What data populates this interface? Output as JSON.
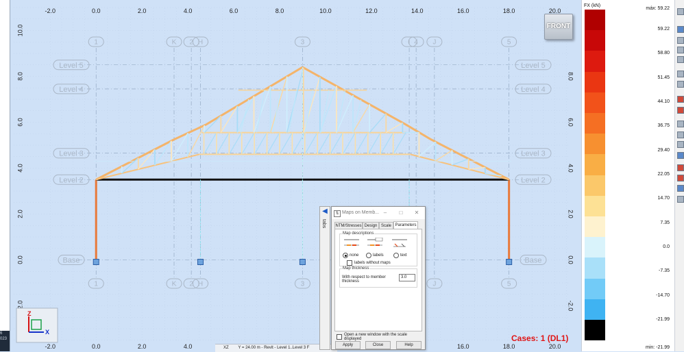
{
  "view": {
    "name": "FRONT",
    "cases_label": "Cases: 1 (DL1)",
    "plane": "XZ",
    "coord_text": "Y = 24.00 m - Revit - Level 1..Level 3 F"
  },
  "x_axis_ticks": [
    "-2.0",
    "0.0",
    "2.0",
    "4.0",
    "6.0",
    "8.0",
    "10.0",
    "12.0",
    "14.0",
    "16.0",
    "18.0",
    "20.0"
  ],
  "y_axis_ticks": [
    "10.0",
    "8.0",
    "6.0",
    "4.0",
    "2.0",
    "0.0",
    "-2.0"
  ],
  "grid_labels_top": [
    "1",
    "K",
    "2",
    "H",
    "3",
    "I",
    "4",
    "J",
    "5"
  ],
  "grid_labels_bottom": [
    "1",
    "K",
    "2",
    "H",
    "3",
    "J",
    "5"
  ],
  "levels": [
    "Level 5",
    "Level 4",
    "Level 3",
    "Level 2",
    "Base"
  ],
  "axes_triad": {
    "z": "Z",
    "x": "X"
  },
  "left_edge_text": "6\n023",
  "tabs_strip": {
    "label": "tabs"
  },
  "dialog": {
    "title": "Maps on Memb...",
    "tabs": [
      "NTM/Stresses",
      "Design",
      "Scale",
      "Parameters"
    ],
    "active_tab": "Parameters",
    "map_descriptions_label": "Map descriptions",
    "radio_options": [
      "none",
      "labels",
      "text"
    ],
    "selected_radio": "none",
    "labels_without_maps": "labels without maps",
    "map_thickness_label": "Map thickness",
    "thickness_caption": "With respect to member thickness",
    "thickness_value": "3.0",
    "open_new_window": "Open a new window with the scale displayed",
    "buttons": [
      "Apply",
      "Close",
      "Help"
    ]
  },
  "legend": {
    "unit": "FX (kN)",
    "max_label": "máx: 59.22",
    "min_label": "min: -21.99",
    "ticks": [
      "59.22",
      "58.80",
      "51.45",
      "44.10",
      "36.75",
      "29.40",
      "22.05",
      "14.70",
      "7.35",
      "0.0",
      "-7.35",
      "-14.70",
      "-21.99"
    ],
    "colors": [
      "#b00000",
      "#c80808",
      "#dd1a0f",
      "#ea3612",
      "#f2521a",
      "#f56f23",
      "#f79030",
      "#f9ae45",
      "#fbc86a",
      "#fde195",
      "#fef2cf",
      "#d9f3fb",
      "#a9e0f9",
      "#72cbf7",
      "#3fb3f2",
      "#000000"
    ]
  }
}
